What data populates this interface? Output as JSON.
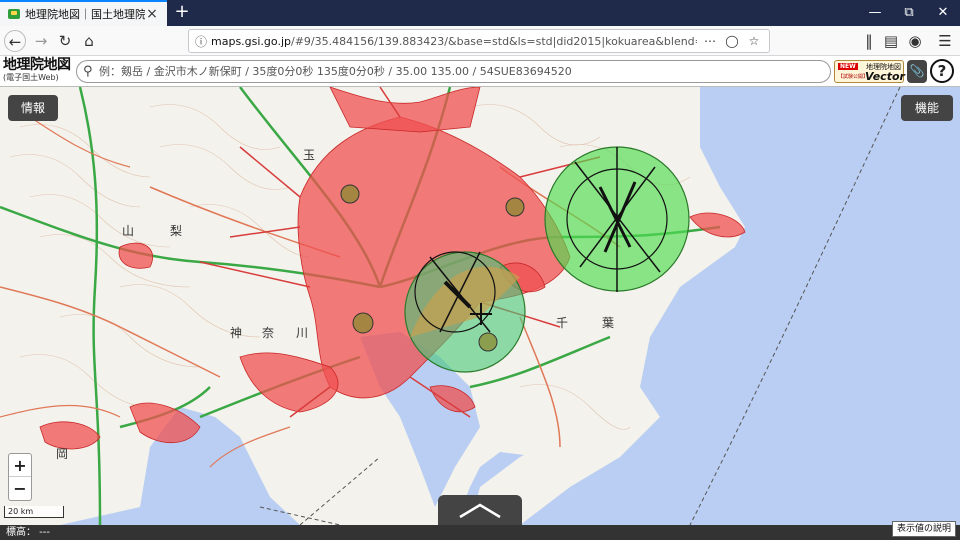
{
  "browser": {
    "tab_title": "地理院地図｜国土地理院",
    "tab_close": "×",
    "new_tab": "+",
    "url_domain": "maps.gsi.go.jp",
    "url_rest": "/#9/35.484156/139.883423/&base=std&ls=std|did2015|kokuarea&blend=0&disp=111&",
    "icons": [
      "back-icon",
      "forward-icon",
      "reload-icon",
      "home-icon",
      "info-icon",
      "more-icon",
      "pocket-icon",
      "bookmark-star-icon",
      "library-icon",
      "sidebar-icon",
      "account-icon",
      "menu-icon"
    ]
  },
  "header": {
    "logo_line1": "地理院地図",
    "logo_line2": "(電子国土Web)",
    "search_placeholder": "例：剱岳 / 金沢市木ノ新保町 / 35度0分0秒 135度0分0秒 / 35.00 135.00 / 54SUE83694520",
    "vector_new": "NEW",
    "vector_sub": "【試験公開】",
    "vector_line1": "地理院地図",
    "vector_line2": "Vector",
    "help": "?"
  },
  "map": {
    "info_button": "情報",
    "function_button": "機能",
    "zoom_in": "+",
    "zoom_out": "−",
    "scale": "20 km",
    "labels": {
      "yamanashi_1": "山",
      "yamanashi_2": "梨",
      "saitama": "玉",
      "kanagawa_1": "神",
      "kanagawa_2": "奈",
      "kanagawa_3": "川",
      "chiba_1": "千",
      "chiba_2": "葉",
      "shizuoka": "岡"
    },
    "colors": {
      "sea": "#b9cef2",
      "land": "#f4f2ec",
      "did_area": "#f05050",
      "airport_zone": "#50dc50",
      "airport_zone_2": "#46c878",
      "road_green": "#3aa845"
    }
  },
  "footer": {
    "elevation": "標高：  ---",
    "legend_button": "表示値の説明"
  }
}
